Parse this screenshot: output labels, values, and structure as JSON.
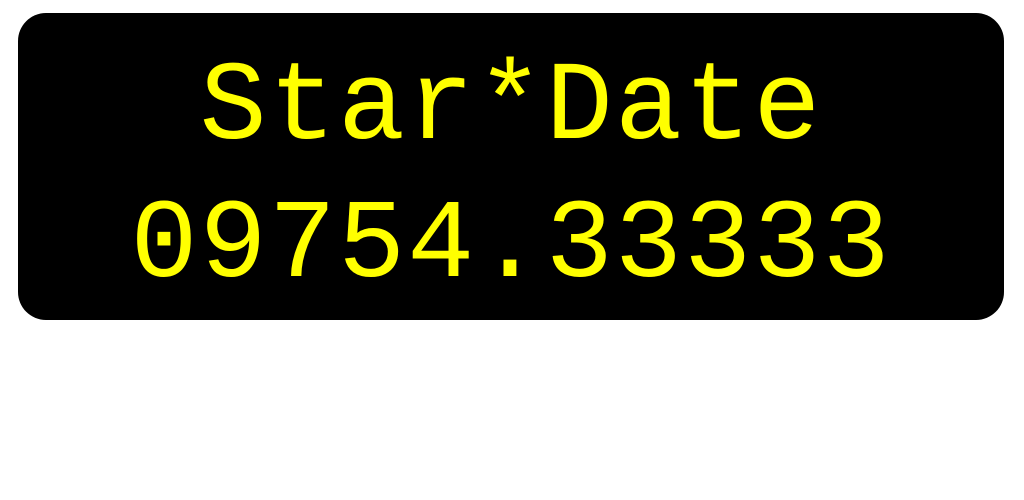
{
  "display": {
    "title": "Star*Date",
    "value": "09754.33333"
  },
  "colors": {
    "panel_background": "#000000",
    "text": "#ffff00",
    "page_background": "#ffffff"
  }
}
